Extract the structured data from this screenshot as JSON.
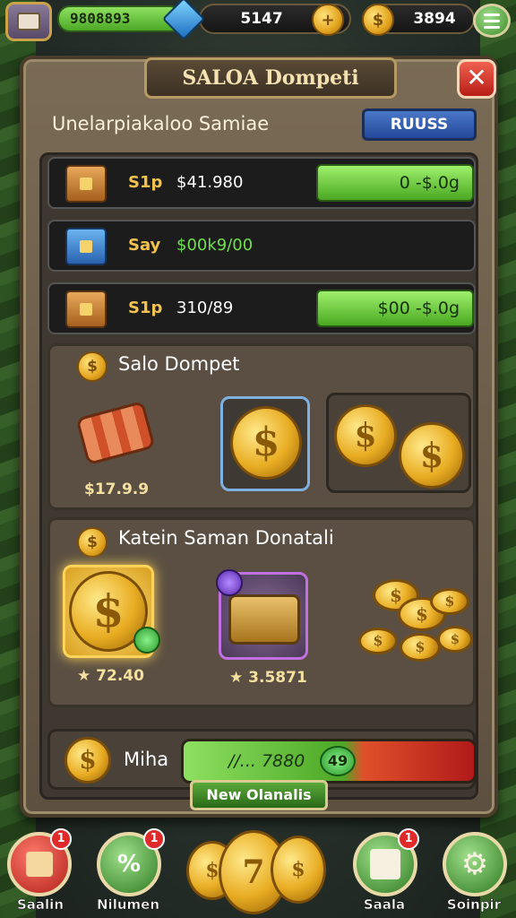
{
  "topbar": {
    "xp_value": "9808893",
    "gem_count": "5147",
    "coin_count": "3894"
  },
  "panel": {
    "title": "SALOA Dompeti",
    "subtitle": "Unelarpiakaloo Samiae",
    "rules_label": "RUUSS",
    "close_symbol": "✕"
  },
  "rows": [
    {
      "label": "S1p",
      "amount": "$41.980",
      "bar_text": "0 -$.0g",
      "icon": "chest-icon"
    },
    {
      "label": "Say",
      "amount": "$00k9/00",
      "bar_text": "",
      "icon": "blue-chest-icon"
    },
    {
      "label": "S1p",
      "amount": "310/89",
      "bar_text": "$00 -$.0g",
      "icon": "chest-icon"
    }
  ],
  "salo_section": {
    "title": "Salo Dompet",
    "gift_price": "$17.9.9"
  },
  "katen_section": {
    "title": "Katein Saman Donatali",
    "coin_price": "72.40",
    "chest_price": "3.5871"
  },
  "miha": {
    "label": "Miha",
    "bar_text": "//... 7880",
    "badge_text": "49"
  },
  "action_button": "New Olanalis",
  "nav": [
    {
      "label": "Saalin",
      "badge": "1"
    },
    {
      "label": "Nilumen",
      "badge": "1"
    },
    {
      "label": "",
      "badge": ""
    },
    {
      "label": "Saala",
      "badge": "1"
    },
    {
      "label": "Soinpir",
      "badge": ""
    }
  ],
  "colors": {
    "accent_green": "#4ca826",
    "gold": "#e8ac22",
    "danger_red": "#b71e16",
    "rules_blue": "#24479a"
  }
}
